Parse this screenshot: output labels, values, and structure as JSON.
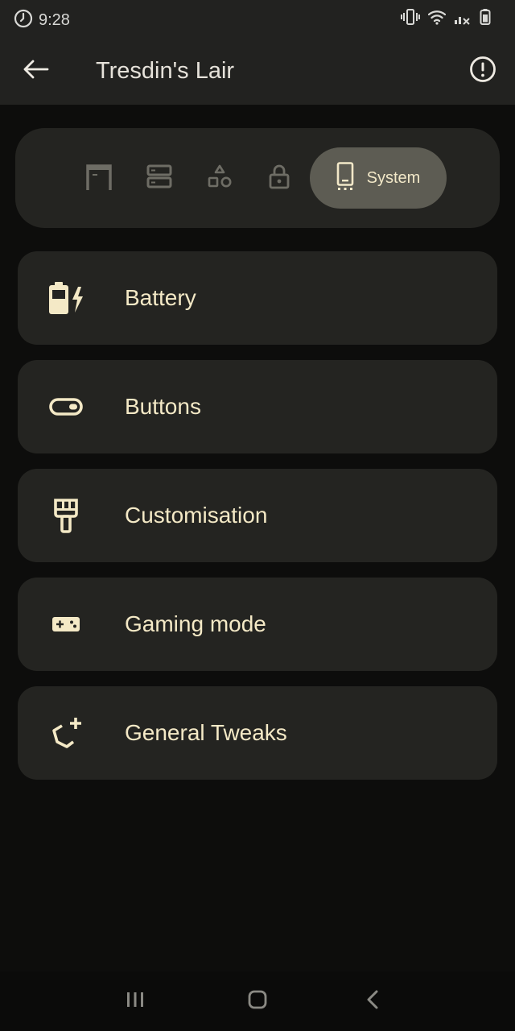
{
  "status_bar": {
    "time": "9:28",
    "icons": [
      "alarm-icon",
      "vibrate-icon",
      "wifi-icon",
      "signal-icon",
      "battery-icon"
    ]
  },
  "app_bar": {
    "title": "Tresdin's Lair",
    "back_icon": "arrow-left-icon",
    "info_icon": "alert-circle-icon"
  },
  "tabs": {
    "items": [
      {
        "icon": "frame-icon"
      },
      {
        "icon": "storage-icon"
      },
      {
        "icon": "shapes-icon"
      },
      {
        "icon": "lock-icon"
      },
      {
        "icon": "phone-icon",
        "label": "System",
        "selected": true
      }
    ]
  },
  "items": [
    {
      "label": "Battery",
      "icon": "battery-charging-icon"
    },
    {
      "label": "Buttons",
      "icon": "toggle-icon"
    },
    {
      "label": "Customisation",
      "icon": "paint-brush-icon"
    },
    {
      "label": "Gaming mode",
      "icon": "gamepad-icon"
    },
    {
      "label": "General Tweaks",
      "icon": "magic-tweaks-icon"
    }
  ],
  "nav_bar": {
    "icons": [
      "recent-apps-icon",
      "home-icon",
      "back-icon"
    ]
  },
  "colors": {
    "background": "#0d0d0c",
    "surface": "#242421",
    "accent_text": "#f4e9c6",
    "selected_tab": "#5d5c53"
  }
}
